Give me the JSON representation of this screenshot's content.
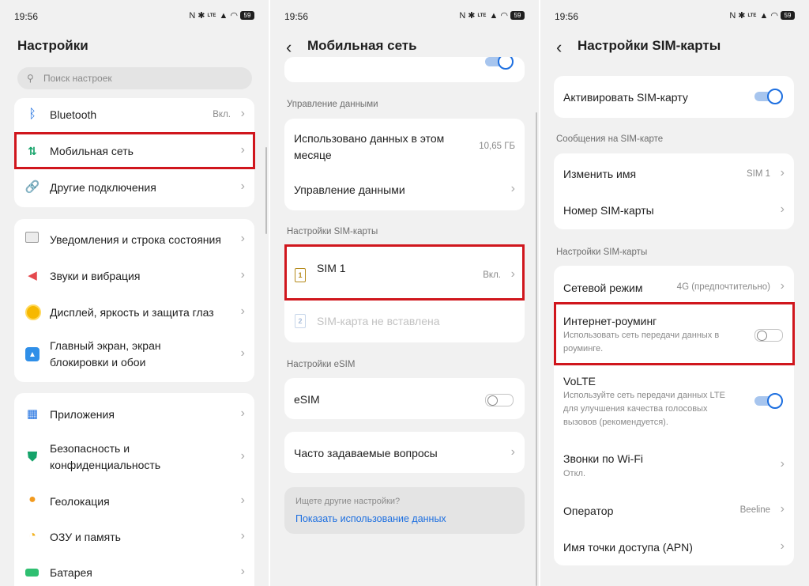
{
  "status_time": "19:56",
  "status_battery": "59",
  "status_lte": "LTE",
  "colors": {
    "accent": "#1d6fe0",
    "highlight": "#d0161d",
    "bg": "#f1f1f1",
    "card": "#ffffff"
  },
  "screen1": {
    "title": "Настройки",
    "search_placeholder": "Поиск настроек",
    "group1": [
      {
        "label": "Bluetooth",
        "value": "Вкл.",
        "icon": "bluetooth-icon"
      },
      {
        "label": "Мобильная сеть",
        "icon": "mobile-data-icon"
      },
      {
        "label": "Другие подключения",
        "icon": "link-icon"
      }
    ],
    "group2": [
      {
        "label": "Уведомления и строка состояния",
        "icon": "notification-icon"
      },
      {
        "label": "Звуки и вибрация",
        "icon": "speaker-icon"
      },
      {
        "label": "Дисплей, яркость и защита глаз",
        "icon": "brightness-icon"
      },
      {
        "label_line1": "Главный экран, экран",
        "label_line2": "блокировки и обои",
        "icon": "wallpaper-icon"
      }
    ],
    "group3": [
      {
        "label": "Приложения",
        "icon": "apps-icon"
      },
      {
        "label_line1": "Безопасность и",
        "label_line2": "конфиденциальность",
        "icon": "shield-icon"
      },
      {
        "label": "Геолокация",
        "icon": "location-icon"
      },
      {
        "label": "ОЗУ и память",
        "icon": "storage-icon"
      },
      {
        "label": "Батарея",
        "icon": "battery-icon"
      }
    ]
  },
  "screen2": {
    "title": "Мобильная сеть",
    "data_section": "Управление данными",
    "data_used_line1": "Использовано данных в этом",
    "data_used_line2": "месяце",
    "data_used_value": "10,65 ГБ",
    "data_manage": "Управление данными",
    "sim_section": "Настройки SIM-карты",
    "sim1_label": "SIM 1",
    "sim1_value": "Вкл.",
    "sim1_num": "1",
    "sim2_label": "SIM-карта не вставлена",
    "sim2_num": "2",
    "esim_section": "Настройки eSIM",
    "esim_label": "eSIM",
    "esim_on": false,
    "faq_label": "Часто задаваемые вопросы",
    "other_hint": "Ищете другие настройки?",
    "other_link": "Показать использование данных"
  },
  "screen3": {
    "title": "Настройки SIM-карты",
    "activate_label": "Активировать SIM-карту",
    "activate_on": true,
    "messages_section": "Сообщения на SIM-карте",
    "rename_label": "Изменить имя",
    "rename_value": "SIM 1",
    "number_label": "Номер SIM-карты",
    "sim_section": "Настройки SIM-карты",
    "network_mode_label": "Сетевой режим",
    "network_mode_value": "4G (предпочтительно)",
    "roaming_label": "Интернет-роуминг",
    "roaming_sub_line1": "Использовать сеть передачи данных в",
    "roaming_sub_line2": "роуминге.",
    "roaming_on": false,
    "volte_label": "VoLTE",
    "volte_sub_line1": "Используйте сеть передачи данных LTE",
    "volte_sub_line2": "для улучшения качества голосовых",
    "volte_sub_line3": "вызовов (рекомендуется).",
    "volte_on": true,
    "wifi_calls_label": "Звонки по Wi-Fi",
    "wifi_calls_sub": "Откл.",
    "operator_label": "Оператор",
    "operator_value": "Beeline",
    "apn_label": "Имя точки доступа (APN)"
  }
}
